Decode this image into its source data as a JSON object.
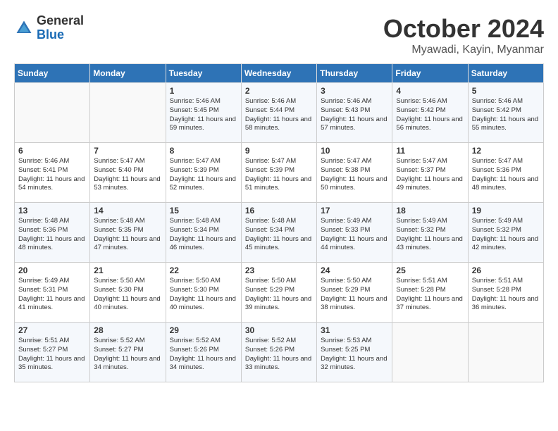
{
  "logo": {
    "general": "General",
    "blue": "Blue"
  },
  "header": {
    "month": "October 2024",
    "location": "Myawadi, Kayin, Myanmar"
  },
  "days_of_week": [
    "Sunday",
    "Monday",
    "Tuesday",
    "Wednesday",
    "Thursday",
    "Friday",
    "Saturday"
  ],
  "weeks": [
    [
      {
        "day": "",
        "sunrise": "",
        "sunset": "",
        "daylight": ""
      },
      {
        "day": "",
        "sunrise": "",
        "sunset": "",
        "daylight": ""
      },
      {
        "day": "1",
        "sunrise": "Sunrise: 5:46 AM",
        "sunset": "Sunset: 5:45 PM",
        "daylight": "Daylight: 11 hours and 59 minutes."
      },
      {
        "day": "2",
        "sunrise": "Sunrise: 5:46 AM",
        "sunset": "Sunset: 5:44 PM",
        "daylight": "Daylight: 11 hours and 58 minutes."
      },
      {
        "day": "3",
        "sunrise": "Sunrise: 5:46 AM",
        "sunset": "Sunset: 5:43 PM",
        "daylight": "Daylight: 11 hours and 57 minutes."
      },
      {
        "day": "4",
        "sunrise": "Sunrise: 5:46 AM",
        "sunset": "Sunset: 5:42 PM",
        "daylight": "Daylight: 11 hours and 56 minutes."
      },
      {
        "day": "5",
        "sunrise": "Sunrise: 5:46 AM",
        "sunset": "Sunset: 5:42 PM",
        "daylight": "Daylight: 11 hours and 55 minutes."
      }
    ],
    [
      {
        "day": "6",
        "sunrise": "Sunrise: 5:46 AM",
        "sunset": "Sunset: 5:41 PM",
        "daylight": "Daylight: 11 hours and 54 minutes."
      },
      {
        "day": "7",
        "sunrise": "Sunrise: 5:47 AM",
        "sunset": "Sunset: 5:40 PM",
        "daylight": "Daylight: 11 hours and 53 minutes."
      },
      {
        "day": "8",
        "sunrise": "Sunrise: 5:47 AM",
        "sunset": "Sunset: 5:39 PM",
        "daylight": "Daylight: 11 hours and 52 minutes."
      },
      {
        "day": "9",
        "sunrise": "Sunrise: 5:47 AM",
        "sunset": "Sunset: 5:39 PM",
        "daylight": "Daylight: 11 hours and 51 minutes."
      },
      {
        "day": "10",
        "sunrise": "Sunrise: 5:47 AM",
        "sunset": "Sunset: 5:38 PM",
        "daylight": "Daylight: 11 hours and 50 minutes."
      },
      {
        "day": "11",
        "sunrise": "Sunrise: 5:47 AM",
        "sunset": "Sunset: 5:37 PM",
        "daylight": "Daylight: 11 hours and 49 minutes."
      },
      {
        "day": "12",
        "sunrise": "Sunrise: 5:47 AM",
        "sunset": "Sunset: 5:36 PM",
        "daylight": "Daylight: 11 hours and 48 minutes."
      }
    ],
    [
      {
        "day": "13",
        "sunrise": "Sunrise: 5:48 AM",
        "sunset": "Sunset: 5:36 PM",
        "daylight": "Daylight: 11 hours and 48 minutes."
      },
      {
        "day": "14",
        "sunrise": "Sunrise: 5:48 AM",
        "sunset": "Sunset: 5:35 PM",
        "daylight": "Daylight: 11 hours and 47 minutes."
      },
      {
        "day": "15",
        "sunrise": "Sunrise: 5:48 AM",
        "sunset": "Sunset: 5:34 PM",
        "daylight": "Daylight: 11 hours and 46 minutes."
      },
      {
        "day": "16",
        "sunrise": "Sunrise: 5:48 AM",
        "sunset": "Sunset: 5:34 PM",
        "daylight": "Daylight: 11 hours and 45 minutes."
      },
      {
        "day": "17",
        "sunrise": "Sunrise: 5:49 AM",
        "sunset": "Sunset: 5:33 PM",
        "daylight": "Daylight: 11 hours and 44 minutes."
      },
      {
        "day": "18",
        "sunrise": "Sunrise: 5:49 AM",
        "sunset": "Sunset: 5:32 PM",
        "daylight": "Daylight: 11 hours and 43 minutes."
      },
      {
        "day": "19",
        "sunrise": "Sunrise: 5:49 AM",
        "sunset": "Sunset: 5:32 PM",
        "daylight": "Daylight: 11 hours and 42 minutes."
      }
    ],
    [
      {
        "day": "20",
        "sunrise": "Sunrise: 5:49 AM",
        "sunset": "Sunset: 5:31 PM",
        "daylight": "Daylight: 11 hours and 41 minutes."
      },
      {
        "day": "21",
        "sunrise": "Sunrise: 5:50 AM",
        "sunset": "Sunset: 5:30 PM",
        "daylight": "Daylight: 11 hours and 40 minutes."
      },
      {
        "day": "22",
        "sunrise": "Sunrise: 5:50 AM",
        "sunset": "Sunset: 5:30 PM",
        "daylight": "Daylight: 11 hours and 40 minutes."
      },
      {
        "day": "23",
        "sunrise": "Sunrise: 5:50 AM",
        "sunset": "Sunset: 5:29 PM",
        "daylight": "Daylight: 11 hours and 39 minutes."
      },
      {
        "day": "24",
        "sunrise": "Sunrise: 5:50 AM",
        "sunset": "Sunset: 5:29 PM",
        "daylight": "Daylight: 11 hours and 38 minutes."
      },
      {
        "day": "25",
        "sunrise": "Sunrise: 5:51 AM",
        "sunset": "Sunset: 5:28 PM",
        "daylight": "Daylight: 11 hours and 37 minutes."
      },
      {
        "day": "26",
        "sunrise": "Sunrise: 5:51 AM",
        "sunset": "Sunset: 5:28 PM",
        "daylight": "Daylight: 11 hours and 36 minutes."
      }
    ],
    [
      {
        "day": "27",
        "sunrise": "Sunrise: 5:51 AM",
        "sunset": "Sunset: 5:27 PM",
        "daylight": "Daylight: 11 hours and 35 minutes."
      },
      {
        "day": "28",
        "sunrise": "Sunrise: 5:52 AM",
        "sunset": "Sunset: 5:27 PM",
        "daylight": "Daylight: 11 hours and 34 minutes."
      },
      {
        "day": "29",
        "sunrise": "Sunrise: 5:52 AM",
        "sunset": "Sunset: 5:26 PM",
        "daylight": "Daylight: 11 hours and 34 minutes."
      },
      {
        "day": "30",
        "sunrise": "Sunrise: 5:52 AM",
        "sunset": "Sunset: 5:26 PM",
        "daylight": "Daylight: 11 hours and 33 minutes."
      },
      {
        "day": "31",
        "sunrise": "Sunrise: 5:53 AM",
        "sunset": "Sunset: 5:25 PM",
        "daylight": "Daylight: 11 hours and 32 minutes."
      },
      {
        "day": "",
        "sunrise": "",
        "sunset": "",
        "daylight": ""
      },
      {
        "day": "",
        "sunrise": "",
        "sunset": "",
        "daylight": ""
      }
    ]
  ]
}
